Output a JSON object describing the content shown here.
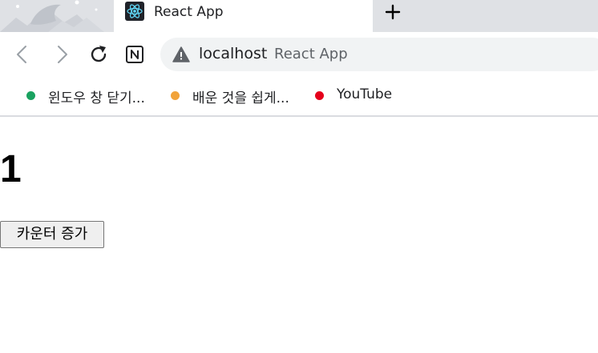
{
  "browser": {
    "tab": {
      "title": "React App",
      "favicon": "react-logo-icon"
    },
    "new_tab_icon": "plus-icon",
    "toolbar": {
      "back_icon": "back-arrow-icon",
      "forward_icon": "forward-arrow-icon",
      "reload_icon": "reload-icon",
      "extension_icon": "notion-icon"
    },
    "omnibox": {
      "security_icon": "warning-icon",
      "host": "localhost",
      "page_title": "React App"
    },
    "bookmarks": [
      {
        "label": "윈도우 창 닫기...",
        "color": "#1aa260"
      },
      {
        "label": "배운 것을 쉽게...",
        "color": "#f1a33a"
      },
      {
        "label": "YouTube",
        "color": "#e5001b"
      }
    ]
  },
  "app": {
    "counter_value": "1",
    "increment_button_label": "카운터 증가"
  }
}
